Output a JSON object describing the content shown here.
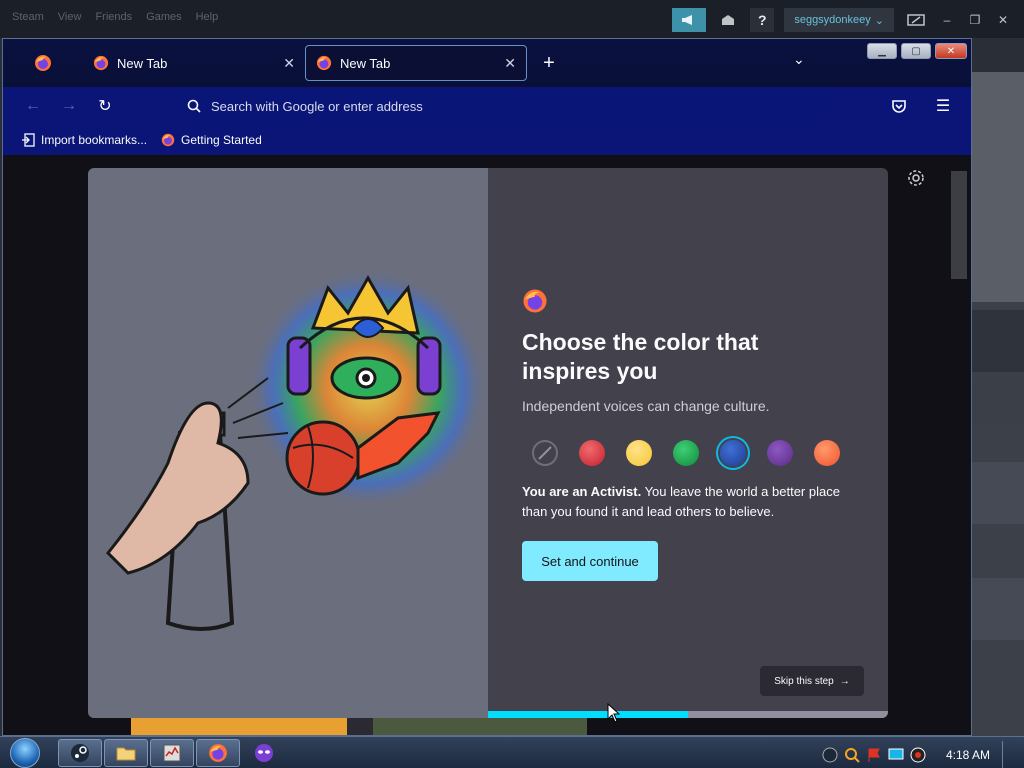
{
  "steam": {
    "menu": [
      "Steam",
      "View",
      "Friends",
      "Games",
      "Help"
    ],
    "help": "?",
    "username": "seggsydonkeey"
  },
  "firefox": {
    "tabs": [
      {
        "title": "New Tab",
        "active": false
      },
      {
        "title": "New Tab",
        "active": true
      }
    ],
    "url_placeholder": "Search with Google or enter address",
    "bookmarks": [
      {
        "label": "Import bookmarks...",
        "icon": "import-icon"
      },
      {
        "label": "Getting Started",
        "icon": "firefox-icon"
      }
    ]
  },
  "onboarding": {
    "title": "Choose the color that inspires you",
    "subtitle": "Independent voices can change culture.",
    "colors": [
      {
        "name": "none",
        "hex": "#42414c"
      },
      {
        "name": "red",
        "hex": "#c4202b"
      },
      {
        "name": "yellow",
        "hex": "#f5c533"
      },
      {
        "name": "green",
        "hex": "#0f8a3c"
      },
      {
        "name": "blue",
        "hex": "#1e3c8f",
        "selected": true
      },
      {
        "name": "purple",
        "hex": "#5b2a86"
      },
      {
        "name": "orange",
        "hex": "#f2522e"
      }
    ],
    "description_bold": "You are an Activist.",
    "description_rest": " You leave the world a better place than you found it and lead others to believe.",
    "primary_button": "Set and continue",
    "skip_button": "Skip this step",
    "progress": 0.5
  },
  "taskbar": {
    "clock": "4:18 AM"
  }
}
